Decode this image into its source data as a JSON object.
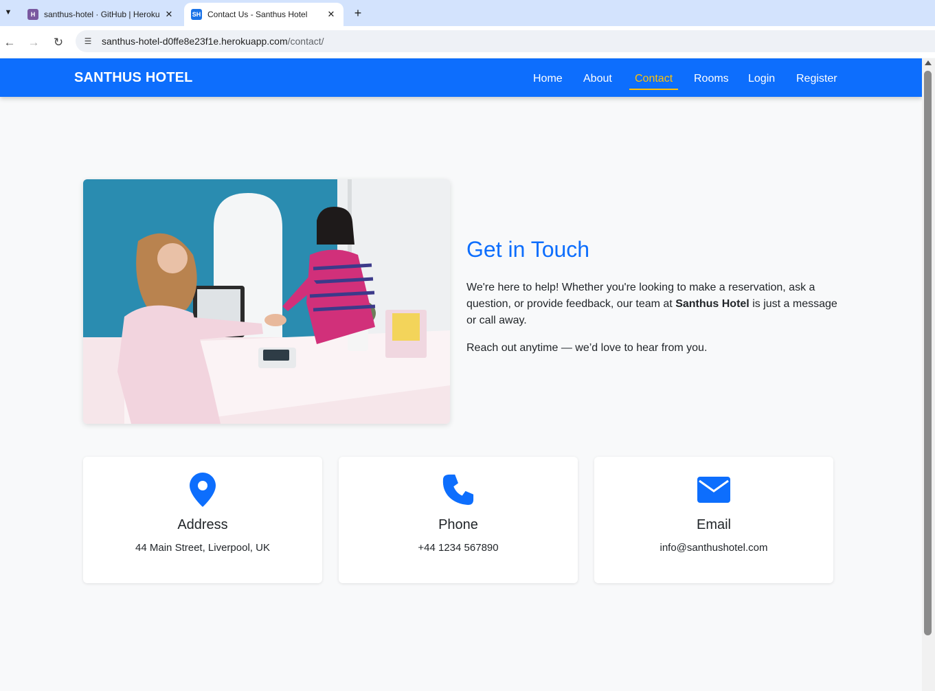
{
  "browser": {
    "tabs": [
      {
        "title": "santhus-hotel · GitHub | Heroku",
        "favicon": "H",
        "active": false
      },
      {
        "title": "Contact Us - Santhus Hotel",
        "favicon": "SH",
        "active": true
      }
    ],
    "url_host": "santhus-hotel-d0ffe8e23f1e.herokuapp.com",
    "url_path": "/contact/"
  },
  "navbar": {
    "brand": "SANTHUS HOTEL",
    "links": [
      "Home",
      "About",
      "Contact",
      "Rooms",
      "Login",
      "Register"
    ],
    "active_link": "Contact",
    "background": "#0d6efd",
    "active_color": "#ffc107"
  },
  "hero": {
    "heading": "Get in Touch",
    "paragraph_start": "We're here to help! Whether you're looking to make a reservation, ask a question, or provide feedback, our team at ",
    "paragraph_bold": "Santhus Hotel",
    "paragraph_end": " is just a message or call away.",
    "paragraph2": "Reach out anytime — we’d love to hear from you."
  },
  "contact_cards": [
    {
      "icon": "map-pin-icon",
      "title": "Address",
      "value": "44 Main Street, Liverpool, UK"
    },
    {
      "icon": "phone-icon",
      "title": "Phone",
      "value": "+44 1234 567890"
    },
    {
      "icon": "envelope-icon",
      "title": "Email",
      "value": "info@santhushotel.com"
    }
  ],
  "colors": {
    "accent": "#0d6efd",
    "page_bg": "#f8f9fa"
  }
}
